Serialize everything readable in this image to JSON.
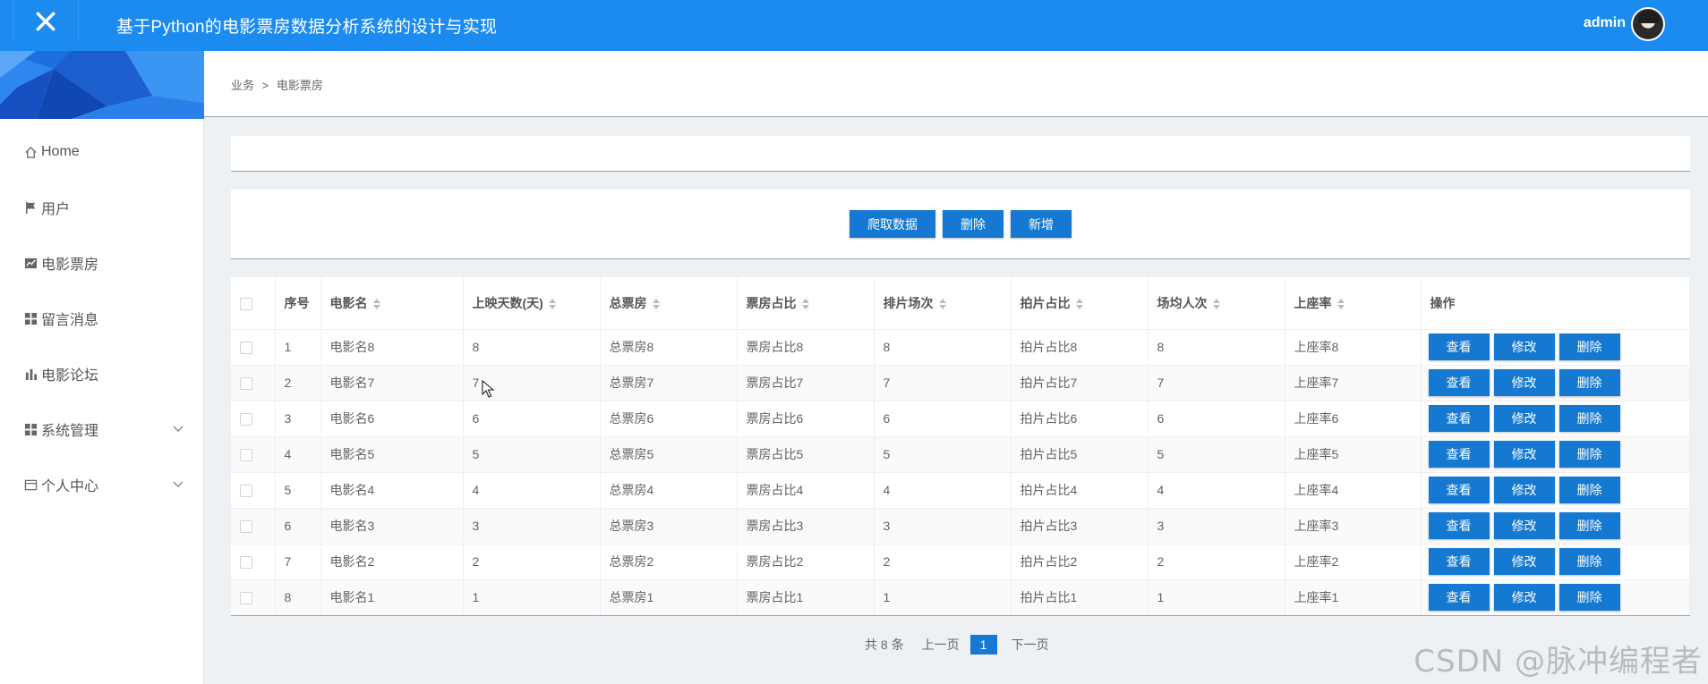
{
  "header": {
    "title": "基于Python的电影票房数据分析系统的设计与实现",
    "user": "admin"
  },
  "sidebar": {
    "items": [
      {
        "label": "Home",
        "icon": "home-icon"
      },
      {
        "label": "用户",
        "icon": "flag-icon"
      },
      {
        "label": "电影票房",
        "icon": "line-chart-icon"
      },
      {
        "label": "留言消息",
        "icon": "grid-icon"
      },
      {
        "label": "电影论坛",
        "icon": "bar-chart-icon"
      },
      {
        "label": "系统管理",
        "icon": "grid-icon"
      },
      {
        "label": "个人中心",
        "icon": "card-icon"
      }
    ]
  },
  "breadcrumb": {
    "parent": "业务",
    "separator": ">",
    "current": "电影票房"
  },
  "actions": {
    "crawl": "爬取数据",
    "delete": "删除",
    "add": "新增"
  },
  "table": {
    "headers": [
      "序号",
      "电影名",
      "上映天数(天)",
      "总票房",
      "票房占比",
      "排片场次",
      "拍片占比",
      "场均人次",
      "上座率",
      "操作"
    ],
    "rows": [
      [
        "1",
        "电影名8",
        "8",
        "总票房8",
        "票房占比8",
        "8",
        "拍片占比8",
        "8",
        "上座率8"
      ],
      [
        "2",
        "电影名7",
        "7",
        "总票房7",
        "票房占比7",
        "7",
        "拍片占比7",
        "7",
        "上座率7"
      ],
      [
        "3",
        "电影名6",
        "6",
        "总票房6",
        "票房占比6",
        "6",
        "拍片占比6",
        "6",
        "上座率6"
      ],
      [
        "4",
        "电影名5",
        "5",
        "总票房5",
        "票房占比5",
        "5",
        "拍片占比5",
        "5",
        "上座率5"
      ],
      [
        "5",
        "电影名4",
        "4",
        "总票房4",
        "票房占比4",
        "4",
        "拍片占比4",
        "4",
        "上座率4"
      ],
      [
        "6",
        "电影名3",
        "3",
        "总票房3",
        "票房占比3",
        "3",
        "拍片占比3",
        "3",
        "上座率3"
      ],
      [
        "7",
        "电影名2",
        "2",
        "总票房2",
        "票房占比2",
        "2",
        "拍片占比2",
        "2",
        "上座率2"
      ],
      [
        "8",
        "电影名1",
        "1",
        "总票房1",
        "票房占比1",
        "1",
        "拍片占比1",
        "1",
        "上座率1"
      ]
    ],
    "row_actions": {
      "view": "查看",
      "edit": "修改",
      "delete": "删除"
    }
  },
  "pagination": {
    "total": "共 8 条",
    "prev": "上一页",
    "current": "1",
    "next": "下一页"
  },
  "watermark": "CSDN @脉冲编程者",
  "colors": {
    "header_bg": "#1b8bf0",
    "button_bg": "#1579d2",
    "page_bg": "#eef1f4"
  }
}
